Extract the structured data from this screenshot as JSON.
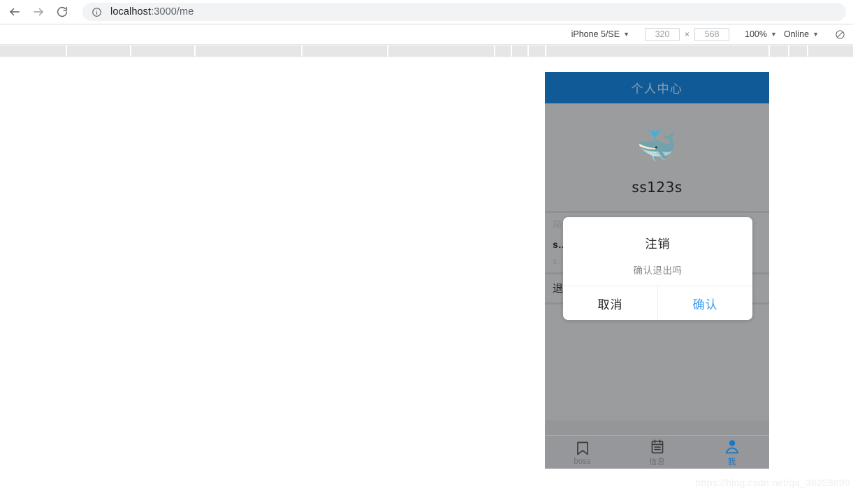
{
  "browser": {
    "back_icon": "back-arrow-icon",
    "forward_icon": "forward-arrow-icon",
    "reload_icon": "reload-icon",
    "info_icon": "page-info-icon",
    "url_host": "localhost",
    "url_path": ":3000/me",
    "url_full": "localhost:3000/me"
  },
  "device_toolbar": {
    "device_label": "iPhone 5/SE",
    "device_caret": "▼",
    "width_value": "320",
    "multiply_symbol": "×",
    "height_value": "568",
    "zoom_label": "100%",
    "zoom_caret": "▼",
    "network_label": "Online",
    "network_caret": "▼",
    "throttle_icon": "no-throttling-icon"
  },
  "app": {
    "header_title": "个人中心",
    "avatar_icon": "whale-avatar",
    "avatar_glyph": "🐳",
    "username": "ss123s",
    "profile_section_label": "简介",
    "profile_value_strong": "s…",
    "profile_value_sub": "s…",
    "logout_row_label": "退…",
    "bottom_nav": [
      {
        "label": "boss",
        "icon": "bookmark-icon",
        "active": false
      },
      {
        "label": "信息",
        "icon": "list-icon",
        "active": false
      },
      {
        "label": "我",
        "icon": "person-icon",
        "active": true
      }
    ]
  },
  "modal": {
    "title": "注销",
    "message": "确认退出吗",
    "cancel_label": "取消",
    "confirm_label": "确认",
    "confirm_color": "#3a9bf0"
  },
  "watermark": {
    "text": "https://blog.csdn.net/qq_36258899"
  },
  "colors": {
    "header_blue": "#0f5a97",
    "phone_bg": "#9a9c9e",
    "accent": "#1677c4"
  }
}
